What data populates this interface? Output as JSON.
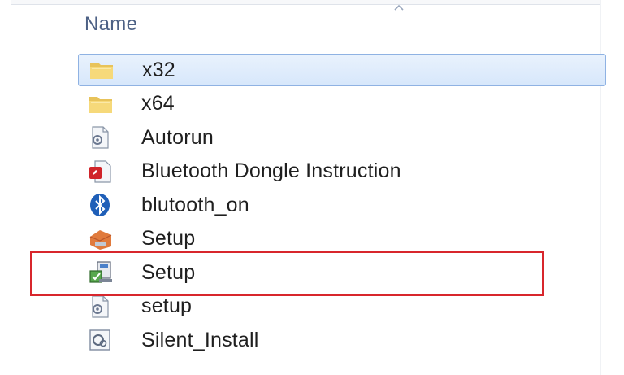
{
  "header": {
    "name_label": "Name",
    "sort_icon": "sort-up-icon"
  },
  "files": [
    {
      "name": "x32",
      "icon": "folder-icon",
      "selected": true
    },
    {
      "name": "x64",
      "icon": "folder-icon",
      "selected": false
    },
    {
      "name": "Autorun",
      "icon": "settings-file-icon",
      "selected": false
    },
    {
      "name": "Bluetooth Dongle Instruction",
      "icon": "pdf-file-icon",
      "selected": false
    },
    {
      "name": "blutooth_on",
      "icon": "bluetooth-icon",
      "selected": false
    },
    {
      "name": "Setup",
      "icon": "setup-package-icon",
      "selected": false
    },
    {
      "name": "Setup",
      "icon": "installer-icon",
      "selected": false,
      "highlighted": true
    },
    {
      "name": "setup",
      "icon": "settings-file-icon",
      "selected": false
    },
    {
      "name": "Silent_Install",
      "icon": "batch-file-icon",
      "selected": false
    }
  ],
  "colors": {
    "highlight": "#d8262c",
    "selection": "#d7e7fb",
    "header_text": "#4d6185"
  }
}
